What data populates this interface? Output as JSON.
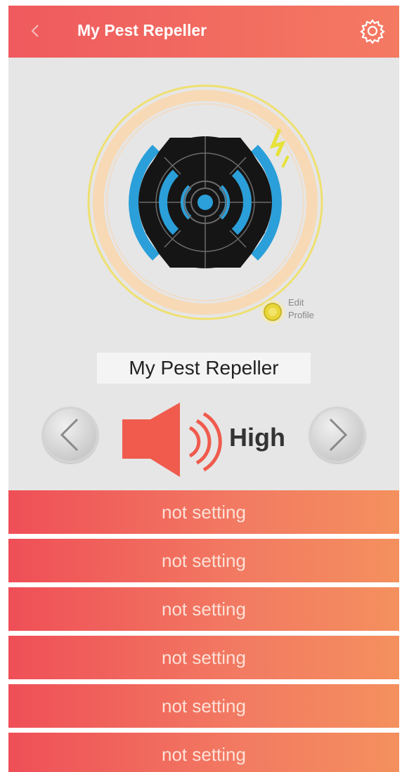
{
  "header": {
    "back_icon": "chevron-left-icon",
    "title": "My Pest Repeller",
    "settings_icon": "gear-icon"
  },
  "dial": {
    "icon": "radar-dial-icon",
    "signal_icon": "lightning-icon"
  },
  "edit_profile": {
    "line1": "Edit",
    "line2": "Profile",
    "icon": "edit-profile-icon"
  },
  "device_name": "My Pest Repeller",
  "volume": {
    "prev_icon": "chevron-left-icon",
    "next_icon": "chevron-right-icon",
    "speaker_icon": "speaker-icon",
    "level": "High"
  },
  "settings": [
    "not setting",
    "not setting",
    "not setting",
    "not setting",
    "not setting",
    "not setting"
  ],
  "colors": {
    "accent": "#ef5a5e",
    "accent_end": "#f4905e",
    "dial_blue": "#2b9fd9",
    "dial_black": "#151515",
    "ring_peach": "#f7d9b5",
    "ring_yellow": "#f0e24a"
  }
}
